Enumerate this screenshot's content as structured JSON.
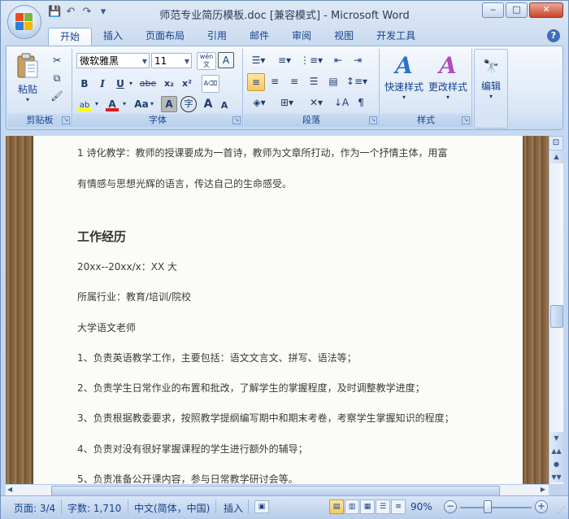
{
  "window": {
    "title": "师范专业简历模板.doc [兼容模式] - Microsoft Word",
    "minimize": "‒",
    "maximize": "□",
    "close": "✕"
  },
  "qat": {
    "save_icon": "💾",
    "undo_icon": "↶",
    "redo_icon": "↷",
    "customize_icon": "▾"
  },
  "tabs": [
    {
      "label": "开始",
      "active": true
    },
    {
      "label": "插入"
    },
    {
      "label": "页面布局"
    },
    {
      "label": "引用"
    },
    {
      "label": "邮件"
    },
    {
      "label": "审阅"
    },
    {
      "label": "视图"
    },
    {
      "label": "开发工具"
    }
  ],
  "help_icon": "?",
  "ribbon": {
    "clipboard": {
      "label": "剪贴板",
      "paste": "粘贴"
    },
    "font": {
      "label": "字体",
      "font_name": "微软雅黑",
      "font_size": "11",
      "bold": "B",
      "italic": "I",
      "underline": "U",
      "strike": "abe",
      "subscript": "x₂",
      "superscript": "x²",
      "font_color": "A",
      "change_case": "Aa",
      "char_shading": "A",
      "phonetic": "字",
      "grow": "A",
      "shrink": "A"
    },
    "paragraph": {
      "label": "段落"
    },
    "styles": {
      "label": "样式",
      "quick_styles": "快速样式",
      "change_styles": "更改样式"
    },
    "editing": {
      "label": "编辑",
      "find": "编辑"
    }
  },
  "document": {
    "lines": [
      "1 诗化教学：教师的授课要成为一首诗，教师为文章所打动，作为一个抒情主体，用富",
      "有情感与思想光辉的语言，传达自己的生命感受。",
      "工作经历",
      "20xx--20xx/x：XX 大",
      "所属行业：教育/培训/院校",
      "大学语文老师",
      "1、负责英语教学工作，主要包括：语文文言文、拼写、语法等；",
      "2、负责学生日常作业的布置和批改，了解学生的掌握程度，及时调整教学进度；",
      "3、负责根据教委要求，按照教学提纲编写期中和期末考卷，考察学生掌握知识的程度；",
      "4、负责对没有很好掌握课程的学生进行额外的辅导；",
      "5、负责准备公开课内容，参与日常教学研讨会等。"
    ]
  },
  "statusbar": {
    "page": "页面: 3/4",
    "words": "字数: 1,710",
    "language": "中文(简体，中国)",
    "insert_mode": "插入",
    "zoom": "90%",
    "zoom_out": "−",
    "zoom_in": "+"
  },
  "colors": {
    "accent": "#15428b",
    "font_color_bar": "#e01b1b",
    "highlight_bar": "#ffff00"
  }
}
